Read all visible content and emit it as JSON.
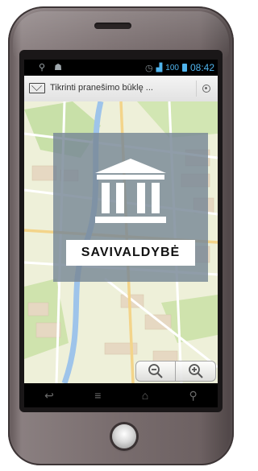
{
  "status_bar": {
    "left_icons": [
      "usb-icon",
      "android-icon"
    ],
    "time": "08:42",
    "battery_text": "100"
  },
  "action_bar": {
    "icon": "envelope-icon",
    "title": "Tikrinti pranešimo būklę ...",
    "right_icon": "locate-icon"
  },
  "overlay": {
    "icon": "building-icon",
    "label": "SAVIVALDYBĖ"
  },
  "map_controls": {
    "zoom_out_icon": "zoom-out-icon",
    "zoom_in_icon": "zoom-in-icon"
  },
  "nav_bar": {
    "items": [
      "back-icon",
      "menu-icon",
      "home-icon",
      "search-icon"
    ]
  },
  "colors": {
    "accent": "#4fb3ec",
    "overlay": "#7888a0",
    "map_bg": "#eef0d9",
    "river": "#9ec4ea"
  }
}
